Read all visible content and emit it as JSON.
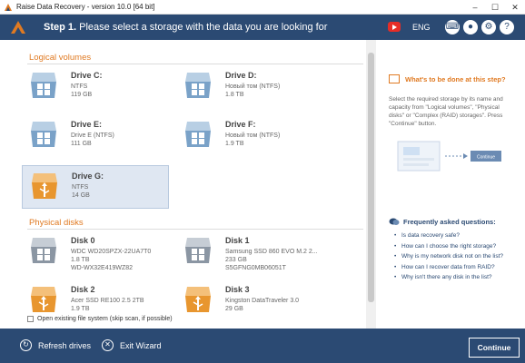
{
  "window": {
    "title": "Raise Data Recovery - version 10.0 [64 bit]",
    "min": "–",
    "max": "☐",
    "close": "✕"
  },
  "header": {
    "step_label": "Step 1.",
    "step_text": " Please select a storage with the data you are looking for",
    "lang": "ENG",
    "icons": [
      "youtube-icon",
      "keyboard-icon",
      "user-icon",
      "gear-icon",
      "help-icon"
    ]
  },
  "logical": {
    "title": "Logical volumes",
    "drives": [
      {
        "name": "Drive C:",
        "fs": "NTFS",
        "size": "119 GB",
        "type": "windows"
      },
      {
        "name": "Drive D:",
        "fs": "Новый том (NTFS)",
        "size": "1.8 TB",
        "type": "windows"
      },
      {
        "name": "Drive E:",
        "fs": "Drive E (NTFS)",
        "size": "111 GB",
        "type": "windows"
      },
      {
        "name": "Drive F:",
        "fs": "Новый том (NTFS)",
        "size": "1.9 TB",
        "type": "windows"
      },
      {
        "name": "Drive G:",
        "fs": "NTFS",
        "size": "14 GB",
        "type": "usb",
        "selected": true
      }
    ]
  },
  "physical": {
    "title": "Physical disks",
    "disks": [
      {
        "name": "Disk 0",
        "model": "WDC WD20SPZX-22UA7T0",
        "size": "1.8 TB",
        "serial": "WD-WX32E419WZ82",
        "type": "hdd"
      },
      {
        "name": "Disk 1",
        "model": "Samsung SSD 860 EVO M.2 2...",
        "size": "233 GB",
        "serial": "S5GFNG0MB06051T",
        "type": "hdd"
      },
      {
        "name": "Disk 2",
        "model": "Acer SSD RE100 2.5 2TB",
        "size": "1.9 TB",
        "serial": "",
        "type": "usb"
      },
      {
        "name": "Disk 3",
        "model": "Kingston DataTraveler 3.0",
        "size": "29 GB",
        "serial": "",
        "type": "usb"
      }
    ]
  },
  "open_existing": "Open existing file system (skip scan, if possible)",
  "help": {
    "title": "What's to be done at this step?",
    "body": "Select the required storage by its name and capacity from \"Logical volumes\", \"Physical disks\" or \"Complex (RAID) storages\". Press \"Continue\" button.",
    "illus_button": "Continue"
  },
  "faq": {
    "title": "Frequently asked questions:",
    "items": [
      "Is data recovery safe?",
      "How can I choose the right storage?",
      "Why is my network disk not on the list?",
      "How can I recover data from RAID?",
      "Why isn't there any disk in the list?"
    ]
  },
  "footer": {
    "refresh": "Refresh drives",
    "exit": "Exit Wizard",
    "continue": "Continue"
  },
  "colors": {
    "brand": "#2b4a73",
    "accent": "#e07a22",
    "selected": "#dfe7f2"
  }
}
